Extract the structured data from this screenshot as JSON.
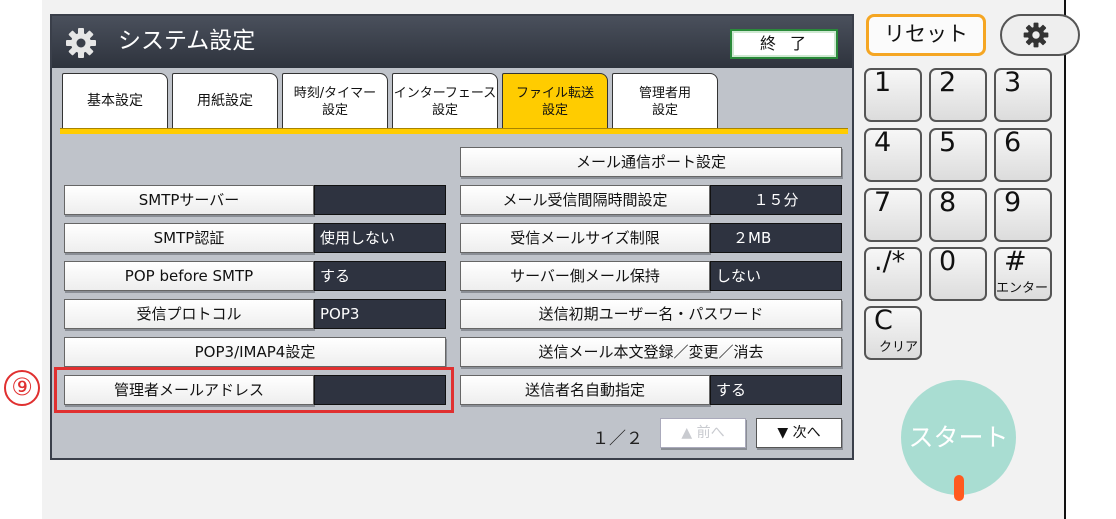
{
  "title": "システム設定",
  "end_button": "終了",
  "tabs": [
    {
      "label": "基本設定",
      "active": false
    },
    {
      "label": "用紙設定",
      "active": false
    },
    {
      "label": "時刻/タイマー\n設定",
      "active": false
    },
    {
      "label": "インターフェース\n設定",
      "active": false
    },
    {
      "label": "ファイル転送\n設定",
      "active": true
    },
    {
      "label": "管理者用\n設定",
      "active": false
    }
  ],
  "left_settings": [
    {
      "label": "SMTPサーバー",
      "value": ""
    },
    {
      "label": "SMTP認証",
      "value": "使用しない"
    },
    {
      "label": "POP before SMTP",
      "value": "する"
    },
    {
      "label": "受信プロトコル",
      "value": "POP3"
    },
    {
      "label": "POP3/IMAP4設定"
    },
    {
      "label": "管理者メールアドレス",
      "value": ""
    }
  ],
  "right_settings": [
    {
      "label": "メール通信ポート設定"
    },
    {
      "label": "メール受信間隔時間設定",
      "value": "１５分"
    },
    {
      "label": "受信メールサイズ制限",
      "value": "２MB"
    },
    {
      "label": "サーバー側メール保持",
      "value": "しない"
    },
    {
      "label": "送信初期ユーザー名・パスワード"
    },
    {
      "label": "送信メール本文登録／変更／消去"
    },
    {
      "label": "送信者名自動指定",
      "value": "する"
    }
  ],
  "pagination": {
    "current": "１／２",
    "prev": "▲ 前へ",
    "next": "▼ 次へ"
  },
  "annotation": "⑨",
  "keypad": {
    "reset": "リセット",
    "keys": [
      {
        "main": "1"
      },
      {
        "main": "2"
      },
      {
        "main": "3"
      },
      {
        "main": "4"
      },
      {
        "main": "5"
      },
      {
        "main": "6"
      },
      {
        "main": "7"
      },
      {
        "main": "8"
      },
      {
        "main": "9"
      },
      {
        "main": "./*"
      },
      {
        "main": "0"
      },
      {
        "main": "#",
        "sub": "エンター"
      },
      {
        "main": "C",
        "sub": "クリア"
      }
    ],
    "start": "スタート"
  },
  "colors": {
    "active_tab": "#ffcc00",
    "value_field": "#2e3340",
    "highlight": "#e03030",
    "reset_border": "#f5a623",
    "start": "#a9ddd2",
    "start_led": "#ff5a1f"
  },
  "icons": {
    "title": "gear-icon",
    "settings": "gear-icon"
  }
}
